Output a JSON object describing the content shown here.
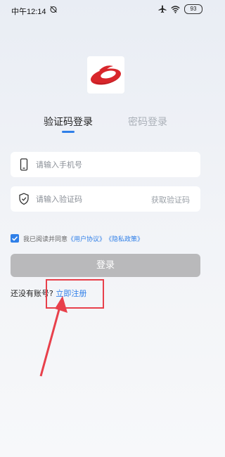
{
  "status_bar": {
    "time": "中午12:14",
    "battery": "93"
  },
  "logo": {
    "icon": "app-logo-icon",
    "accent": "#d8262b"
  },
  "tabs": [
    {
      "label": "验证码登录",
      "active": true
    },
    {
      "label": "密码登录",
      "active": false
    }
  ],
  "phone_field": {
    "placeholder": "请输入手机号",
    "value": "",
    "icon": "phone-icon"
  },
  "code_field": {
    "placeholder": "请输入验证码",
    "value": "",
    "icon": "shield-icon",
    "get_code_label": "获取验证码"
  },
  "agreement": {
    "checked": true,
    "prefix": "我已阅读并同意",
    "user_agreement": "《用户协议》",
    "privacy_policy": "《隐私政策》"
  },
  "login": {
    "label": "登录"
  },
  "register": {
    "prompt": "还没有账号?",
    "link": "立即注册"
  },
  "colors": {
    "accent": "#2f7fe8",
    "annotation": "#e8404b",
    "disabled_button": "#b9b9bb"
  }
}
